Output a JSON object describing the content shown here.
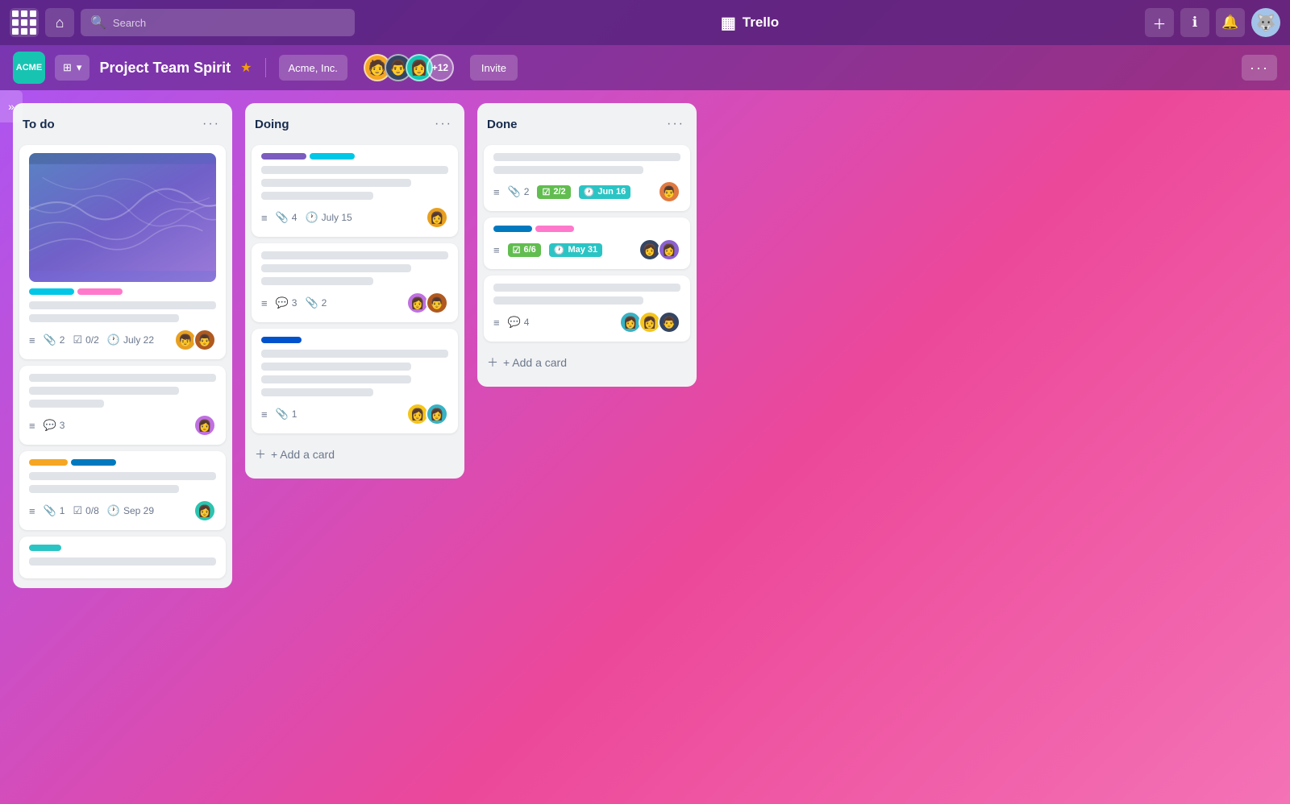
{
  "app": {
    "title": "Trello",
    "icon": "▦"
  },
  "topNav": {
    "appsBtn": "⋯",
    "homeBtn": "⌂",
    "searchPlaceholder": "Search",
    "createBtn": "+",
    "infoBtn": "ℹ",
    "notifBtn": "🔔",
    "moreDots": "···"
  },
  "boardHeader": {
    "workspaceLogo": "ACME",
    "workspaceName": "⊞ ···",
    "boardTitle": "Project Team Spirit",
    "starIcon": "★",
    "divider": true,
    "workspaceLabel": "Acme, Inc.",
    "memberCount": "+12",
    "inviteLabel": "Invite",
    "moreBtn": "···"
  },
  "sidebar": {
    "toggleIcon": "»"
  },
  "lists": [
    {
      "id": "todo",
      "title": "To do",
      "menuDots": "···",
      "cards": [
        {
          "id": "todo-1",
          "hasCover": true,
          "labels": [
            "cyan",
            "pink"
          ],
          "metaIcons": [
            "≡",
            "📎",
            "☑",
            "🕐"
          ],
          "metaValues": [
            "",
            "2",
            "0/2",
            "July 22"
          ],
          "avatars": [
            "orange-man",
            "brown-man"
          ],
          "avatarEmojis": [
            "🧑",
            "👨"
          ]
        },
        {
          "id": "todo-2",
          "hasCover": false,
          "labels": [],
          "metaIcons": [
            "≡",
            "💬"
          ],
          "metaValues": [
            "",
            "3"
          ],
          "avatars": [
            "purple-woman"
          ],
          "avatarEmojis": [
            "👩"
          ]
        },
        {
          "id": "todo-3",
          "hasCover": false,
          "labels": [
            "yellow",
            "blue"
          ],
          "metaIcons": [
            "≡",
            "📎",
            "☑",
            "🕐"
          ],
          "metaValues": [
            "",
            "1",
            "0/8",
            "Sep 29"
          ],
          "avatars": [
            "teal-woman"
          ],
          "avatarEmojis": [
            "👩"
          ]
        },
        {
          "id": "todo-4",
          "hasCover": false,
          "labels": [
            "teal"
          ],
          "metaIcons": [],
          "metaValues": [],
          "avatars": [],
          "avatarEmojis": []
        }
      ],
      "addCardLabel": "+ Add a card"
    },
    {
      "id": "doing",
      "title": "Doing",
      "menuDots": "···",
      "cards": [
        {
          "id": "doing-1",
          "hasCover": false,
          "labels": [
            "purple",
            "cyan"
          ],
          "metaIcons": [
            "≡",
            "📎",
            "🕐"
          ],
          "metaValues": [
            "",
            "4",
            "July 15"
          ],
          "avatars": [
            "orange-woman"
          ],
          "avatarEmojis": [
            "👩"
          ]
        },
        {
          "id": "doing-2",
          "hasCover": false,
          "labels": [],
          "metaIcons": [
            "≡",
            "💬",
            "📎"
          ],
          "metaValues": [
            "",
            "3",
            "2"
          ],
          "avatars": [
            "purple-woman",
            "brown-man"
          ],
          "avatarEmojis": [
            "👩",
            "👨"
          ]
        },
        {
          "id": "doing-3",
          "hasCover": false,
          "labels": [
            "blue"
          ],
          "metaIcons": [
            "≡",
            "📎"
          ],
          "metaValues": [
            "",
            "1"
          ],
          "avatars": [
            "yellow-woman",
            "teal-woman2"
          ],
          "avatarEmojis": [
            "👩",
            "👩"
          ]
        }
      ],
      "addCardLabel": "+ Add a card"
    },
    {
      "id": "done",
      "title": "Done",
      "menuDots": "···",
      "cards": [
        {
          "id": "done-1",
          "hasCover": false,
          "labels": [],
          "badges": [
            {
              "type": "green",
              "icon": "☑",
              "text": "2/2"
            },
            {
              "type": "teal",
              "icon": "🕐",
              "text": "Jun 16"
            }
          ],
          "metaIcons": [
            "≡",
            "📎"
          ],
          "metaValues": [
            "",
            "2"
          ],
          "avatars": [
            "red-man"
          ],
          "avatarEmojis": [
            "👨"
          ]
        },
        {
          "id": "done-2",
          "hasCover": false,
          "labels": [
            "blue",
            "pink"
          ],
          "badges": [
            {
              "type": "green",
              "icon": "☑",
              "text": "6/6"
            },
            {
              "type": "teal",
              "icon": "🕐",
              "text": "May 31"
            }
          ],
          "metaIcons": [
            "≡"
          ],
          "metaValues": [
            ""
          ],
          "avatars": [
            "dark-woman",
            "purple-woman2"
          ],
          "avatarEmojis": [
            "👩",
            "👩"
          ]
        },
        {
          "id": "done-3",
          "hasCover": false,
          "labels": [],
          "metaIcons": [
            "≡",
            "💬"
          ],
          "metaValues": [
            "",
            "4"
          ],
          "avatars": [
            "teal-woman3",
            "yellow-woman2",
            "dark-man2"
          ],
          "avatarEmojis": [
            "👩",
            "👩",
            "👨"
          ]
        }
      ],
      "addCardLabel": "+ Add a card"
    }
  ]
}
